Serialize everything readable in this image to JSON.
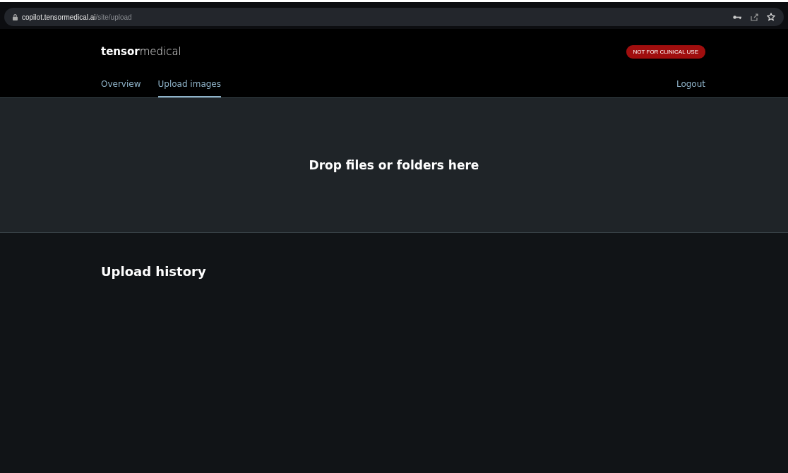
{
  "browser": {
    "url_host": "copilot.tensormedical.ai",
    "url_path": "/site/upload"
  },
  "header": {
    "logo": "**tensor**medical",
    "badge": "NOT FOR CLINICAL USE",
    "tabs": [
      {
        "label": "Overview",
        "selected": false
      },
      {
        "label": "Upload images",
        "selected": true
      }
    ],
    "logout": "Logout"
  },
  "dropzone": {
    "text": "Drop files or folders here"
  },
  "history": {
    "title": "Upload history"
  }
}
